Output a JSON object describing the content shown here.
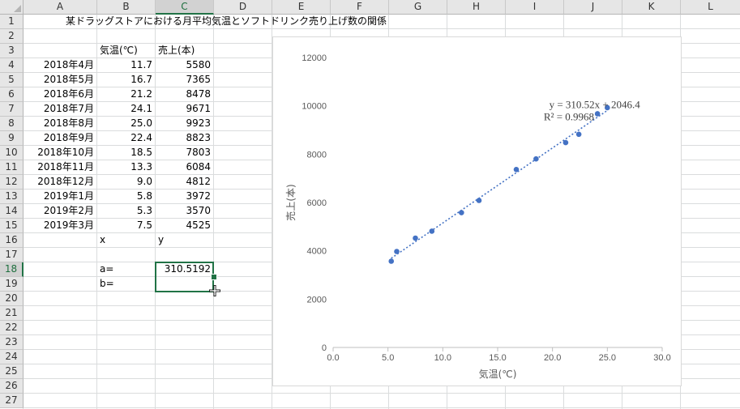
{
  "columns": [
    "A",
    "B",
    "C",
    "D",
    "E",
    "F",
    "G",
    "H",
    "I",
    "J",
    "K",
    "L"
  ],
  "selected_column": "C",
  "selected_row": 18,
  "rows": [
    "1",
    "2",
    "3",
    "4",
    "5",
    "6",
    "7",
    "8",
    "9",
    "10",
    "11",
    "12",
    "13",
    "14",
    "15",
    "16",
    "17",
    "18",
    "19",
    "20",
    "21",
    "22",
    "23",
    "24",
    "25",
    "26",
    "27"
  ],
  "sheet": {
    "title": "某ドラッグストアにおける月平均気温とソフトドリンク売り上げ数の関係",
    "header_temp": "気温(℃)",
    "header_sales": "売上(本)",
    "data_rows": [
      {
        "month": "2018年4月",
        "temp": "11.7",
        "sales": "5580"
      },
      {
        "month": "2018年5月",
        "temp": "16.7",
        "sales": "7365"
      },
      {
        "month": "2018年6月",
        "temp": "21.2",
        "sales": "8478"
      },
      {
        "month": "2018年7月",
        "temp": "24.1",
        "sales": "9671"
      },
      {
        "month": "2018年8月",
        "temp": "25.0",
        "sales": "9923"
      },
      {
        "month": "2018年9月",
        "temp": "22.4",
        "sales": "8823"
      },
      {
        "month": "2018年10月",
        "temp": "18.5",
        "sales": "7803"
      },
      {
        "month": "2018年11月",
        "temp": "13.3",
        "sales": "6084"
      },
      {
        "month": "2018年12月",
        "temp": "9.0",
        "sales": "4812"
      },
      {
        "month": "2019年1月",
        "temp": "5.8",
        "sales": "3972"
      },
      {
        "month": "2019年2月",
        "temp": "5.3",
        "sales": "3570"
      },
      {
        "month": "2019年3月",
        "temp": "7.5",
        "sales": "4525"
      }
    ],
    "label_x": "x",
    "label_y": "y",
    "label_a": "a=",
    "label_b": "b=",
    "value_a": "310.5192",
    "value_b": ""
  },
  "chart_data": {
    "type": "scatter",
    "x": [
      11.7,
      16.7,
      21.2,
      24.1,
      25.0,
      22.4,
      18.5,
      13.3,
      9.0,
      5.8,
      5.3,
      7.5
    ],
    "y": [
      5580,
      7365,
      8478,
      9671,
      9923,
      8823,
      7803,
      6084,
      4812,
      3972,
      3570,
      4525
    ],
    "xlabel": "気温(℃)",
    "ylabel": "売上(本)",
    "xlim": [
      0,
      30
    ],
    "ylim": [
      0,
      12000
    ],
    "x_ticks": [
      "0.0",
      "5.0",
      "10.0",
      "15.0",
      "20.0",
      "25.0",
      "30.0"
    ],
    "y_ticks": [
      "0",
      "2000",
      "4000",
      "6000",
      "8000",
      "10000",
      "12000"
    ],
    "trendline": {
      "slope": 310.52,
      "intercept": 2046.4,
      "x_range": [
        5.3,
        25.0
      ]
    },
    "equation_label": "y = 310.52x + 2046.4",
    "r2_label": "R² = 0.9968",
    "grid": false,
    "marker_color": "#4472c4"
  },
  "colors": {
    "selection": "#217346",
    "gridline": "#dadcdd",
    "header_bg": "#e6e6e6"
  }
}
